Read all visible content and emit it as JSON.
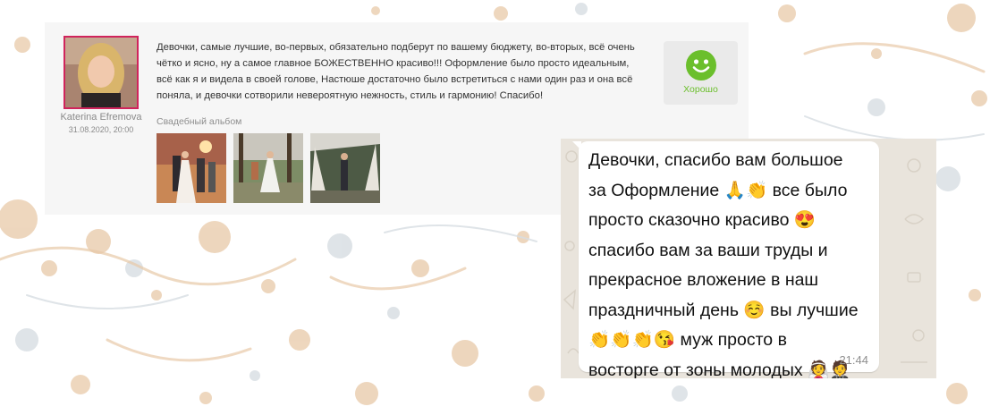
{
  "review": {
    "reviewer_name": "Katerina Efremova",
    "date": "31.08.2020, 20:00",
    "text": "Девочки, самые лучшие, во-первых, обязательно подберут по вашему бюджету, во-вторых, всё очень чётко и ясно, ну а самое главное БОЖЕСТВЕННО красиво!!! Оформление было просто идеальным, всё как я и видела в своей голове, Настюше достаточно было встретиться с нами один раз и она всё поняла, и девочки сотворили невероятную нежность, стиль и гармонию! Спасибо!",
    "album_label": "Свадебный альбом",
    "rating_label": "Хорошо",
    "rating_color": "#6bbf2c",
    "accent_color": "#d0245c"
  },
  "chat": {
    "lines": [
      "Девочки, спасибо вам большое",
      "за Оформление 🙏👏 все было",
      "просто сказочно красиво 😍",
      "спасибо вам за ваши труды и",
      "прекрасное вложение в наш",
      "праздничный день ☺️ вы лучшие",
      "👏👏👏😘 муж просто в",
      "восторге от зоны молодых 👰🤵"
    ],
    "time": "21:44"
  }
}
